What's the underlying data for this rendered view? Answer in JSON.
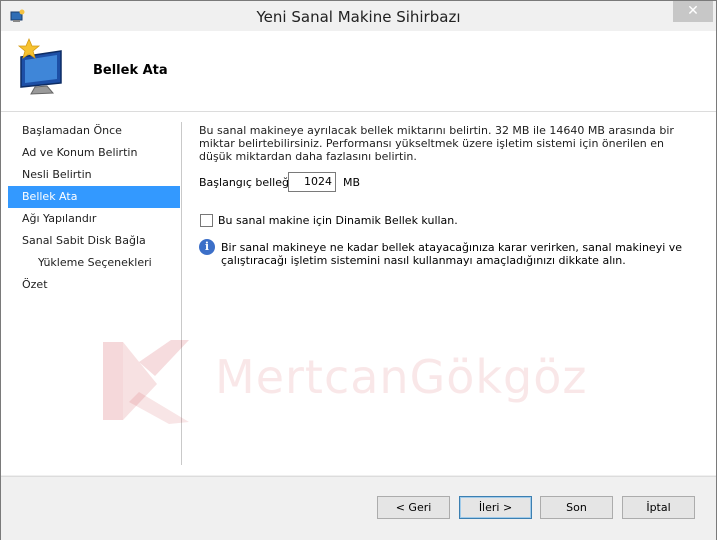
{
  "window": {
    "title": "Yeni Sanal Makine Sihirbazı",
    "close_label": "✕"
  },
  "header": {
    "title": "Bellek Ata"
  },
  "nav": {
    "items": [
      {
        "label": "Başlamadan Önce"
      },
      {
        "label": "Ad ve Konum Belirtin"
      },
      {
        "label": "Nesli Belirtin"
      },
      {
        "label": "Bellek Ata"
      },
      {
        "label": "Ağı Yapılandır"
      },
      {
        "label": "Sanal Sabit Disk Bağla"
      },
      {
        "label": "Yükleme Seçenekleri"
      },
      {
        "label": "Özet"
      }
    ]
  },
  "main": {
    "description": "Bu sanal makineye ayrılacak bellek miktarını belirtin. 32 MB ile 14640 MB arasında bir miktar belirtebilirsiniz. Performansı yükseltmek üzere işletim sistemi için önerilen en düşük miktardan daha fazlasını belirtin.",
    "startup_memory_label": "Başlangıç belleği:",
    "startup_memory_value": "1024",
    "startup_memory_unit": "MB",
    "dynamic_memory_label": "Bu sanal makine için Dinamik Bellek kullan.",
    "info_text": "Bir sanal makineye ne kadar bellek atayacağınıza karar verirken, sanal makineyi ve çalıştıracağı işletim sistemini nasıl kullanmayı amaçladığınızı dikkate alın."
  },
  "watermark": {
    "text": "MertcanGökgöz"
  },
  "buttons": {
    "back": "< Geri",
    "next": "İleri >",
    "finish": "Son",
    "cancel": "İptal"
  },
  "colors": {
    "selection": "#3399ff",
    "info_icon": "#3c6fc8"
  },
  "icons": {
    "app": "hyper-v-computer-icon",
    "header": "new-virtual-machine-icon",
    "info": "info-icon",
    "close": "close-icon"
  }
}
